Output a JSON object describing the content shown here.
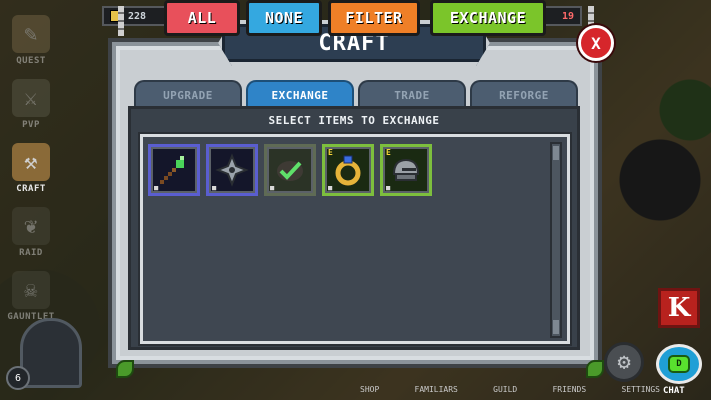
{
  "hud": {
    "gold": "228",
    "gems": "19"
  },
  "left_menu": [
    {
      "label": "QUEST",
      "icon": "scroll-icon"
    },
    {
      "label": "PVP",
      "icon": "crossed-swords-icon"
    },
    {
      "label": "CRAFT",
      "icon": "anvil-icon"
    },
    {
      "label": "RAID",
      "icon": "leaf-shield-icon"
    },
    {
      "label": "GAUNTLET",
      "icon": "skull-icon"
    }
  ],
  "player": {
    "level": "6"
  },
  "dialog": {
    "title": "CRAFT",
    "close": "X",
    "tabs": [
      {
        "label": "UPGRADE",
        "active": false
      },
      {
        "label": "EXCHANGE",
        "active": true
      },
      {
        "label": "TRADE",
        "active": false
      },
      {
        "label": "REFORGE",
        "active": false
      }
    ],
    "subtitle": "SELECT ITEMS TO EXCHANGE",
    "items": [
      {
        "name": "green-staff-item",
        "border": "#5a5ed0",
        "bg": "#14162a",
        "equip": "",
        "qty": "■"
      },
      {
        "name": "shuriken-item",
        "border": "#5a5ed0",
        "bg": "#14162a",
        "equip": "",
        "qty": "■"
      },
      {
        "name": "ore-checked-item",
        "border": "#5f6b55",
        "bg": "#2b3326",
        "equip": "",
        "qty": "■"
      },
      {
        "name": "gold-ring-item",
        "border": "#7dbf3d",
        "bg": "#1a2a12",
        "equip": "E",
        "qty": "■"
      },
      {
        "name": "iron-helmet-item",
        "border": "#7dbf3d",
        "bg": "#1a2a12",
        "equip": "E",
        "qty": "■"
      }
    ]
  },
  "actions": {
    "all": {
      "label": "ALL",
      "color": "#e8505b"
    },
    "none": {
      "label": "NONE",
      "color": "#34a8e0"
    },
    "filter": {
      "label": "FILTER",
      "color": "#ef7f27"
    },
    "exchange": {
      "label": "EXCHANGE",
      "color": "#7bc52a"
    }
  },
  "bottom_nav": [
    "SHOP",
    "FAMILIARS",
    "GUILD",
    "FRIENDS",
    "SETTINGS"
  ],
  "chat": {
    "label": "CHAT",
    "badge": "D"
  },
  "k_badge": "K"
}
